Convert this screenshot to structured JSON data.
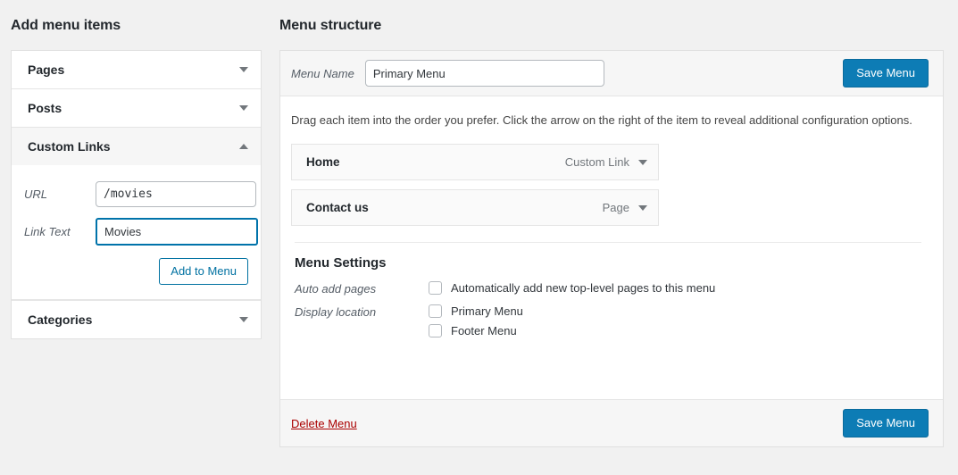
{
  "left_panel": {
    "title": "Add menu items",
    "sections": [
      {
        "label": "Pages",
        "state": "collapsed",
        "arrow": "chevron-down-icon"
      },
      {
        "label": "Posts",
        "state": "collapsed",
        "arrow": "chevron-down-icon"
      },
      {
        "label": "Custom Links",
        "state": "expanded",
        "arrow": "chevron-up-icon"
      },
      {
        "label": "Categories",
        "state": "collapsed",
        "arrow": "chevron-down-icon"
      }
    ],
    "custom_links_form": {
      "url_label": "URL",
      "url_value": "/movies",
      "link_text_label": "Link Text",
      "link_text_value": "Movies",
      "add_button_label": "Add to Menu"
    }
  },
  "right_panel": {
    "title": "Menu structure",
    "menu_name_label": "Menu Name",
    "menu_name_value": "Primary Menu",
    "save_top_label": "Save Menu",
    "hint": "Drag each item into the order you prefer. Click the arrow on the right of the item to reveal additional configuration options.",
    "menu_items": [
      {
        "title": "Home",
        "type": "Custom Link"
      },
      {
        "title": "Contact us",
        "type": "Page"
      }
    ],
    "settings": {
      "heading": "Menu Settings",
      "auto_add_label": "Auto add pages",
      "auto_add_option": "Automatically add new top-level pages to this menu",
      "auto_add_checked": false,
      "display_location_label": "Display location",
      "locations": [
        {
          "label": "Primary Menu",
          "checked": false
        },
        {
          "label": "Footer Menu",
          "checked": false
        }
      ]
    },
    "footer": {
      "delete_label": "Delete Menu",
      "save_label": "Save Menu"
    }
  },
  "colors": {
    "primary_button": "#0d7cb5",
    "link_blue": "#0071a1",
    "delete_red": "#a00000",
    "focus_border": "#0073aa",
    "page_background": "#f1f1f1"
  }
}
